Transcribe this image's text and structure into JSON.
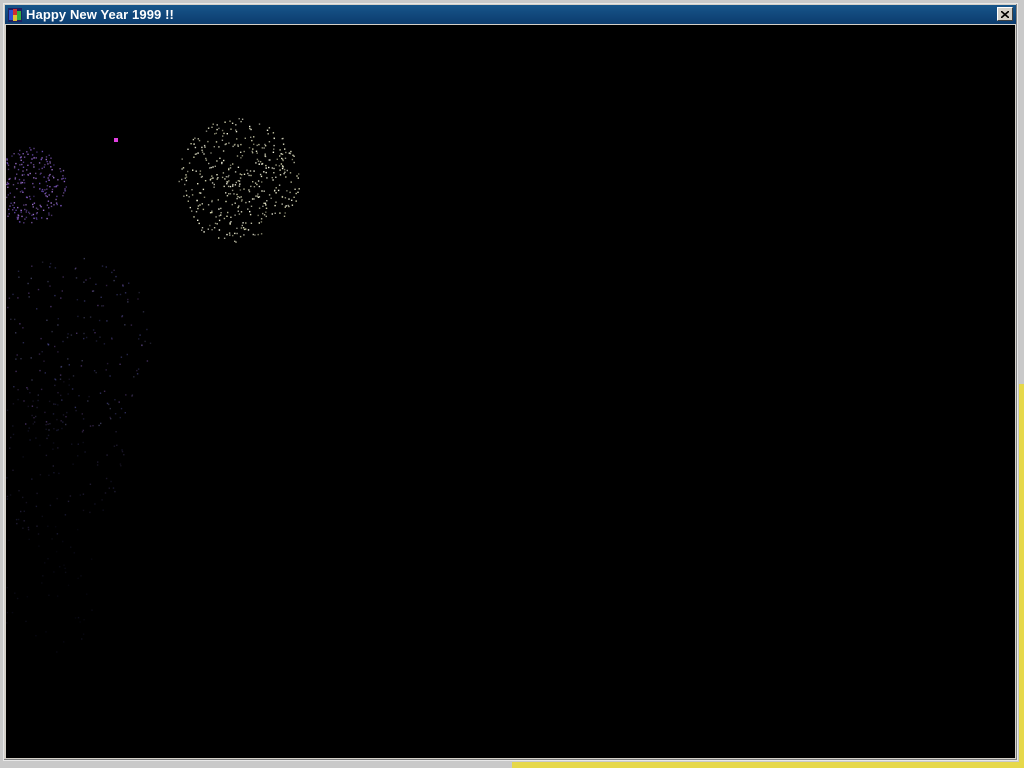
{
  "window": {
    "title": "Happy New Year 1999 !!",
    "icon": "fireworks-app-icon",
    "close_icon": "close-icon"
  },
  "colors": {
    "titlebar": "#0c3c6e",
    "canvas_background": "#000000",
    "burst_white": "#f0f0d0",
    "burst_purple": "#9a6ad8",
    "spark_magenta": "#e040e0"
  }
}
